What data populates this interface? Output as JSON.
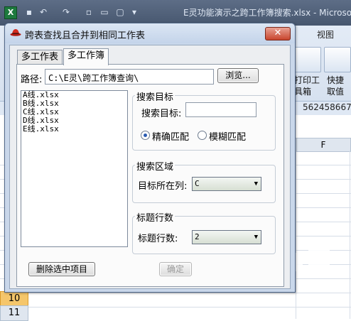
{
  "excel": {
    "logo": "X",
    "title": "E灵功能演示之跨工作簿搜索.xlsx - Microso",
    "tab_view": "视图",
    "ribbon_labels": [
      "打印工",
      "快捷",
      "具箱",
      "取值"
    ],
    "number": "562458667",
    "col_f": "F",
    "row_10": "10",
    "row_11": "11"
  },
  "dialog": {
    "title": "跨表查找且合并到相同工作表",
    "close": "✕",
    "tabs": [
      "多工作表",
      "多工作簿"
    ],
    "path_label": "路径:",
    "path_value": "C:\\E灵\\跨工作簿查询\\",
    "browse": "浏览...",
    "files": [
      "A线.xlsx",
      "B线.xlsx",
      "C线.xlsx",
      "D线.xlsx",
      "E线.xlsx"
    ],
    "search_target": {
      "group": "搜索目标",
      "label": "搜索目标:",
      "value": "",
      "exact": "精确匹配",
      "fuzzy": "模糊匹配",
      "selected": "exact"
    },
    "search_range": {
      "group": "搜索区域",
      "label": "目标所在列:",
      "value": "C"
    },
    "header_rows": {
      "group": "标题行数",
      "label": "标题行数:",
      "value": "2"
    },
    "delete_button": "删除选中项目",
    "ok_button": "确定"
  }
}
